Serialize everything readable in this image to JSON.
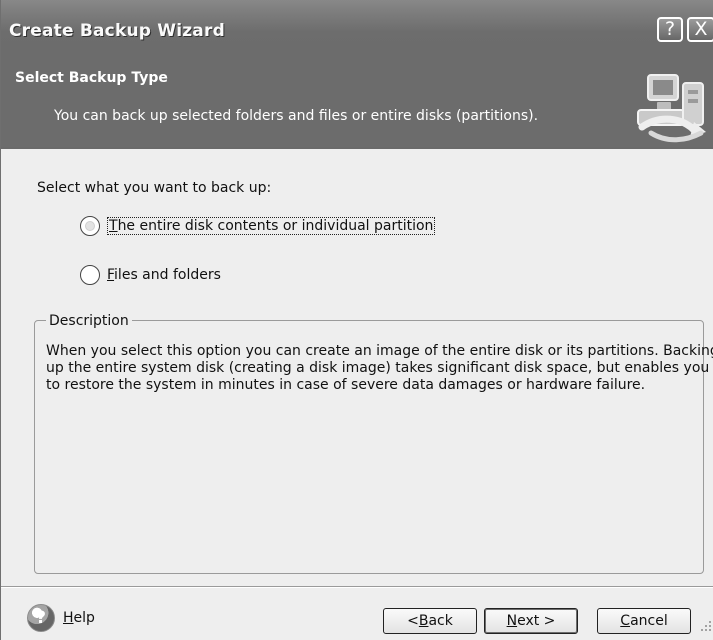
{
  "window": {
    "title": "Create Backup Wizard",
    "help_icon_glyph": "?",
    "close_icon_glyph": "X"
  },
  "header": {
    "title": "Select Backup Type",
    "subtitle": "You can back up selected folders and files or entire disks (partitions)."
  },
  "content": {
    "prompt": "Select what you want to back up:",
    "options": [
      {
        "underlined": "T",
        "rest": "he entire disk contents or individual partition",
        "selected": true,
        "focused": true
      },
      {
        "underlined": "F",
        "rest": "iles and folders",
        "selected": false,
        "focused": false
      }
    ]
  },
  "description": {
    "legend": "Description",
    "lines": [
      "When you select this option you can create an image of the entire disk or its partitions. Backing",
      "up the entire system disk (creating a disk image) takes significant disk space, but enables you",
      "to restore the system in minutes in case of severe data damages or hardware failure."
    ]
  },
  "footer": {
    "help": {
      "icon_glyph": "?",
      "underlined": "H",
      "rest": "elp"
    },
    "back": {
      "prefix": "< ",
      "underlined": "B",
      "rest": "ack"
    },
    "next": {
      "underlined": "N",
      "rest": "ext >"
    },
    "cancel": {
      "underlined": "C",
      "rest": "ancel"
    }
  },
  "colors": {
    "title_bar": "#7a7a7a",
    "header_background": "#6c6c6c",
    "dialog_background": "#eeeeee",
    "text": "#111111"
  },
  "icons": {
    "title_help": "help-icon",
    "title_close": "close-icon",
    "wizard_logo": "backup-computer-icon",
    "footer_help": "help-circle-icon",
    "resize_grip": "resize-grip-icon"
  }
}
